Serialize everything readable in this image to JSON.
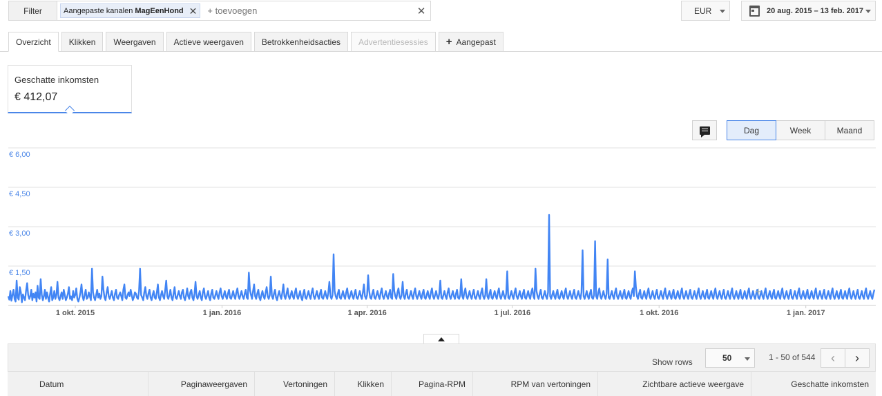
{
  "filter": {
    "button_label": "Filter",
    "chip_prefix": "Aangepaste kanalen ",
    "chip_value": "MagEenHond",
    "add_placeholder": "+ toevoegen"
  },
  "currency": {
    "selected": "EUR"
  },
  "date_range": {
    "label": "20 aug. 2015 – 13 feb. 2017"
  },
  "tabs": [
    {
      "label": "Overzicht",
      "state": "active"
    },
    {
      "label": "Klikken",
      "state": "normal"
    },
    {
      "label": "Weergaven",
      "state": "normal"
    },
    {
      "label": "Actieve weergaven",
      "state": "normal"
    },
    {
      "label": "Betrokkenheidsacties",
      "state": "normal"
    },
    {
      "label": "Advertentiesessies",
      "state": "disabled"
    },
    {
      "label": "Aangepast",
      "state": "normal",
      "icon": "plus-icon"
    }
  ],
  "scorecard": {
    "label": "Geschatte inkomsten",
    "value": "€ 412,07"
  },
  "granularity": {
    "options": [
      "Dag",
      "Week",
      "Maand"
    ],
    "selected": "Dag"
  },
  "chart_data": {
    "type": "line",
    "series": [
      {
        "color": "#4285f4",
        "values": [
          0.35,
          0.22,
          0.55,
          0.18,
          0.4,
          0.6,
          0.25,
          0.15,
          0.95,
          0.3,
          0.22,
          0.7,
          0.5,
          0.12,
          0.42,
          0.3,
          0.2,
          0.55,
          0.85,
          0.4,
          0.25,
          0.35,
          0.6,
          0.2,
          0.45,
          0.3,
          0.5,
          0.15,
          0.75,
          0.3,
          0.25,
          1.0,
          0.4,
          0.2,
          0.35,
          0.6,
          0.25,
          0.5,
          0.3,
          0.15,
          0.45,
          0.7,
          0.2,
          0.3,
          0.55,
          0.25,
          0.4,
          0.9,
          0.3,
          0.2,
          0.35,
          0.5,
          0.25,
          0.6,
          0.4,
          0.2,
          0.3,
          0.45,
          0.7,
          0.25,
          0.35,
          0.2,
          0.55,
          0.3,
          0.4,
          0.65,
          0.25,
          0.15,
          0.3,
          0.5,
          0.8,
          0.35,
          0.2,
          0.4,
          0.6,
          0.25,
          0.3,
          0.5,
          0.35,
          0.2,
          1.4,
          0.5,
          0.3,
          0.2,
          0.4,
          0.6,
          0.3,
          0.45,
          0.25,
          0.35,
          1.1,
          0.6,
          0.3,
          0.2,
          0.5,
          0.7,
          0.35,
          0.25,
          0.4,
          0.55,
          0.3,
          0.2,
          0.45,
          0.6,
          0.3,
          0.25,
          0.4,
          0.5,
          0.35,
          0.2,
          0.6,
          0.8,
          0.3,
          0.25,
          0.4,
          0.5,
          0.35,
          0.6,
          0.4,
          0.2,
          0.3,
          0.5,
          0.45,
          0.3,
          0.25,
          0.55,
          1.4,
          0.4,
          0.3,
          0.2,
          0.5,
          0.7,
          0.35,
          0.25,
          0.45,
          0.6,
          0.3,
          0.2,
          0.4,
          0.55,
          0.3,
          0.25,
          0.5,
          0.8,
          0.3,
          0.2,
          0.4,
          0.55,
          0.35,
          0.25,
          0.6,
          0.95,
          0.35,
          0.25,
          0.4,
          0.6,
          0.3,
          0.2,
          0.45,
          0.7,
          0.3,
          0.25,
          0.4,
          0.55,
          0.35,
          0.25,
          0.5,
          0.6,
          0.3,
          0.2,
          0.4,
          0.65,
          0.35,
          0.25,
          0.5,
          0.6,
          0.3,
          0.2,
          0.45,
          0.9,
          0.35,
          0.25,
          0.4,
          0.55,
          0.3,
          0.2,
          0.5,
          0.65,
          0.35,
          0.25,
          0.4,
          0.55,
          0.3,
          0.2,
          0.45,
          0.6,
          0.3,
          0.25,
          0.4,
          0.55,
          0.35,
          0.25,
          0.5,
          0.65,
          0.35,
          0.25,
          0.4,
          0.55,
          0.35,
          0.25,
          0.45,
          0.6,
          0.3,
          0.25,
          0.4,
          0.55,
          0.35,
          0.25,
          0.5,
          0.65,
          0.35,
          0.25,
          0.4,
          0.55,
          0.35,
          0.25,
          0.45,
          0.6,
          0.3,
          0.25,
          1.25,
          0.6,
          0.4,
          0.25,
          0.55,
          0.8,
          0.35,
          0.25,
          0.45,
          0.6,
          0.3,
          0.2,
          0.4,
          0.55,
          0.35,
          0.25,
          0.5,
          0.7,
          0.35,
          0.25,
          0.4,
          1.1,
          0.35,
          0.25,
          0.45,
          0.6,
          0.3,
          0.2,
          0.4,
          0.55,
          0.35,
          0.25,
          0.5,
          0.8,
          0.35,
          0.25,
          0.45,
          0.65,
          0.35,
          0.25,
          0.4,
          0.55,
          0.35,
          0.25,
          0.5,
          0.65,
          0.35,
          0.25,
          0.4,
          0.55,
          0.3,
          0.2,
          0.45,
          0.6,
          0.3,
          0.25,
          0.4,
          0.55,
          0.35,
          0.25,
          0.5,
          0.65,
          0.35,
          0.25,
          0.4,
          0.55,
          0.35,
          0.25,
          0.45,
          0.6,
          0.3,
          0.25,
          0.4,
          0.55,
          0.35,
          0.25,
          0.5,
          0.9,
          0.35,
          0.25,
          0.4,
          1.95,
          0.55,
          0.35,
          0.25,
          0.45,
          0.6,
          0.3,
          0.25,
          0.4,
          0.55,
          0.35,
          0.25,
          0.5,
          0.65,
          0.35,
          0.25,
          0.4,
          0.55,
          0.35,
          0.25,
          0.45,
          0.6,
          0.3,
          0.25,
          0.4,
          0.55,
          0.35,
          0.25,
          0.5,
          0.8,
          0.35,
          0.25,
          0.4,
          1.15,
          0.55,
          0.3,
          0.25,
          0.45,
          0.6,
          0.3,
          0.25,
          0.4,
          0.55,
          0.35,
          0.25,
          0.5,
          0.65,
          0.35,
          0.25,
          0.4,
          0.55,
          0.35,
          0.25,
          0.45,
          0.6,
          0.3,
          0.25,
          1.2,
          0.55,
          0.35,
          0.25,
          0.5,
          0.65,
          0.35,
          0.25,
          0.4,
          0.9,
          0.35,
          0.25,
          0.45,
          0.6,
          0.3,
          0.25,
          0.4,
          0.55,
          0.35,
          0.25,
          0.5,
          0.65,
          0.35,
          0.25,
          0.4,
          0.55,
          0.35,
          0.25,
          0.45,
          0.6,
          0.3,
          0.25,
          0.4,
          0.55,
          0.35,
          0.25,
          0.5,
          0.65,
          0.35,
          0.25,
          0.4,
          0.55,
          0.35,
          0.25,
          0.45,
          0.95,
          0.3,
          0.25,
          0.4,
          0.55,
          0.35,
          0.25,
          0.5,
          0.65,
          0.35,
          0.25,
          0.4,
          0.55,
          0.35,
          0.25,
          0.45,
          0.6,
          0.3,
          0.25,
          0.4,
          1.0,
          0.35,
          0.25,
          0.5,
          0.65,
          0.35,
          0.25,
          0.4,
          0.55,
          0.35,
          0.25,
          0.45,
          0.6,
          0.3,
          0.25,
          0.4,
          0.55,
          0.35,
          0.25,
          0.5,
          0.65,
          0.35,
          0.25,
          0.4,
          1.0,
          0.35,
          0.25,
          0.45,
          0.6,
          0.3,
          0.25,
          0.4,
          0.55,
          0.35,
          0.25,
          0.5,
          0.65,
          0.35,
          0.25,
          0.4,
          0.55,
          0.35,
          0.25,
          0.45,
          1.3,
          0.3,
          0.25,
          0.4,
          0.55,
          0.35,
          0.25,
          0.5,
          0.65,
          0.35,
          0.25,
          0.4,
          0.55,
          0.35,
          0.25,
          0.45,
          0.6,
          0.3,
          0.25,
          0.4,
          0.55,
          0.35,
          0.25,
          0.5,
          0.65,
          0.35,
          0.25,
          1.4,
          0.55,
          0.35,
          0.25,
          0.45,
          0.6,
          0.3,
          0.25,
          0.4,
          0.55,
          0.35,
          0.25,
          0.5,
          3.45,
          0.35,
          0.25,
          0.4,
          0.55,
          0.35,
          0.25,
          0.45,
          0.6,
          0.3,
          0.25,
          0.4,
          0.55,
          0.35,
          0.25,
          0.5,
          0.65,
          0.35,
          0.25,
          0.4,
          0.55,
          0.35,
          0.25,
          0.45,
          0.6,
          0.3,
          0.25,
          0.4,
          0.55,
          0.35,
          0.25,
          0.5,
          2.1,
          0.35,
          0.25,
          0.4,
          0.55,
          0.35,
          0.25,
          0.45,
          0.6,
          0.3,
          0.25,
          0.4,
          2.45,
          0.35,
          0.25,
          0.5,
          0.65,
          0.35,
          0.25,
          0.4,
          0.55,
          0.35,
          0.25,
          0.45,
          1.75,
          0.3,
          0.25,
          0.4,
          0.55,
          0.35,
          0.25,
          0.5,
          0.65,
          0.35,
          0.25,
          0.4,
          0.55,
          0.35,
          0.25,
          0.45,
          0.6,
          0.3,
          0.25,
          0.4,
          0.55,
          0.35,
          0.25,
          0.5,
          0.65,
          0.35,
          1.3,
          0.7,
          0.35,
          0.25,
          0.45,
          0.6,
          0.3,
          0.25,
          0.4,
          0.55,
          0.35,
          0.25,
          0.5,
          0.65,
          0.35,
          0.25,
          0.4,
          0.55,
          0.35,
          0.25,
          0.45,
          0.6,
          0.3,
          0.25,
          0.4,
          0.55,
          0.35,
          0.25,
          0.5,
          0.65,
          0.35,
          0.25,
          0.4,
          0.55,
          0.35,
          0.25,
          0.45,
          0.6,
          0.3,
          0.25,
          0.4,
          0.55,
          0.35,
          0.25,
          0.5,
          0.65,
          0.35,
          0.25,
          0.4,
          0.55,
          0.35,
          0.25,
          0.45,
          0.6,
          0.3,
          0.25,
          0.4,
          0.55,
          0.35,
          0.25,
          0.5,
          0.65,
          0.35,
          0.25,
          0.4,
          0.55,
          0.35,
          0.25,
          0.45,
          0.6,
          0.3,
          0.25,
          0.4,
          0.55,
          0.35,
          0.25,
          0.5,
          0.65,
          0.35,
          0.25,
          0.4,
          0.55,
          0.35,
          0.25,
          0.45,
          0.6,
          0.3,
          0.25,
          0.4,
          0.55,
          0.35,
          0.25,
          0.5,
          0.65,
          0.35,
          0.25,
          0.4,
          0.55,
          0.35,
          0.25,
          0.45,
          0.6,
          0.3,
          0.25,
          0.4,
          0.55,
          0.35,
          0.25,
          0.5,
          0.65,
          0.35,
          0.25,
          0.4,
          0.55,
          0.35,
          0.25,
          0.45,
          0.6,
          0.3,
          0.25,
          0.4,
          0.55,
          0.35,
          0.25,
          0.5,
          0.65,
          0.35,
          0.25,
          0.4,
          0.55,
          0.35,
          0.25,
          0.45,
          0.6,
          0.3,
          0.25,
          0.4,
          0.55,
          0.35,
          0.25,
          0.5,
          0.65,
          0.35,
          0.25,
          0.4,
          0.55,
          0.35,
          0.25,
          0.45,
          0.6,
          0.3,
          0.25,
          0.4,
          0.55,
          0.35,
          0.25,
          0.5,
          0.65,
          0.35,
          0.25,
          0.4,
          0.55,
          0.35,
          0.25,
          0.45,
          0.6,
          0.3,
          0.25,
          0.4,
          0.55,
          0.35,
          0.25,
          0.5,
          0.65,
          0.35,
          0.25,
          0.4,
          0.55,
          0.35,
          0.25,
          0.45,
          0.6,
          0.3,
          0.25,
          0.4,
          0.55,
          0.35,
          0.25,
          0.5,
          0.65,
          0.35,
          0.25,
          0.4,
          0.55,
          0.35,
          0.25,
          0.45,
          0.6,
          0.3,
          0.25,
          0.4,
          0.55,
          0.35,
          0.25,
          0.5,
          0.65,
          0.35,
          0.25,
          0.4,
          0.55,
          0.35,
          0.25,
          0.45,
          0.6,
          0.3,
          0.25,
          0.4,
          0.55,
          0.35,
          0.25,
          0.5,
          0.65,
          0.35,
          0.25,
          0.4,
          0.55,
          0.35,
          0.25,
          0.45,
          0.6
        ]
      }
    ],
    "y_ticks": [
      "€ 6,00",
      "€ 4,50",
      "€ 3,00",
      "€ 1,50"
    ],
    "y_tick_values": [
      6.0,
      4.5,
      3.0,
      1.5
    ],
    "ylim": [
      0,
      6.0
    ],
    "x_ticks": [
      "1 okt. 2015",
      "1 jan. 2016",
      "1 apr. 2016",
      "1 jul. 2016",
      "1 okt. 2016",
      "1 jan. 2017"
    ],
    "x_tick_day_index": [
      42,
      134,
      225,
      316,
      408,
      500
    ],
    "x_day_count": 544,
    "grid": true
  },
  "table": {
    "show_rows_label": "Show rows",
    "rows_selected": "50",
    "page_info": "1 - 50 of 544",
    "columns": [
      "Datum",
      "Paginaweergaven",
      "Vertoningen",
      "Klikken",
      "Pagina-RPM",
      "RPM van vertoningen",
      "Zichtbare actieve weergave",
      "Geschatte inkomsten"
    ]
  }
}
